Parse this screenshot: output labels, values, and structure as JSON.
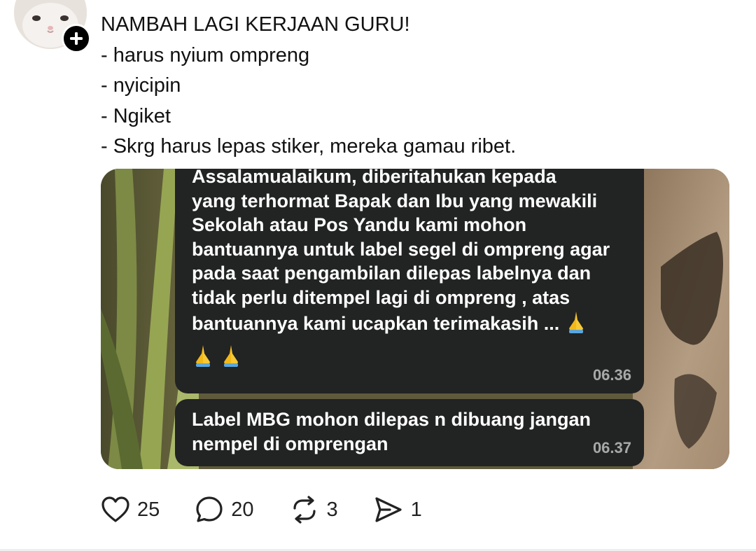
{
  "post": {
    "lines": [
      "NAMBAH LAGI KERJAAN GURU!",
      "- harus nyium ompreng",
      "- nyicipin",
      "- Ngiket",
      "- Skrg harus lepas stiker, mereka gamau ribet."
    ]
  },
  "chat": {
    "message1": {
      "lines": [
        "Assalamualaikum,  diberitahukan kepada",
        "yang terhormat Bapak dan Ibu yang mewakili",
        "Sekolah atau Pos Yandu kami mohon",
        "bantuannya untuk label segel di ompreng agar",
        "pada saat pengambilan dilepas labelnya dan",
        "tidak perlu ditempel lagi di ompreng , atas",
        "bantuannya kami ucapkan terimakasih ..."
      ],
      "time": "06.36"
    },
    "message2": {
      "lines": [
        "Label MBG mohon dilepas n dibuang jangan",
        "nempel di omprengan"
      ],
      "time": "06.37"
    }
  },
  "actions": {
    "likes": "25",
    "replies": "20",
    "reposts": "3",
    "shares": "1"
  },
  "icons": {
    "follow": "plus-icon",
    "like": "heart-icon",
    "reply": "comment-icon",
    "repost": "repost-icon",
    "share": "send-icon",
    "emoji": "folded-hands-icon"
  },
  "colors": {
    "bubble": "#222323",
    "timestamp": "#a7a9a9",
    "text": "#111111"
  }
}
